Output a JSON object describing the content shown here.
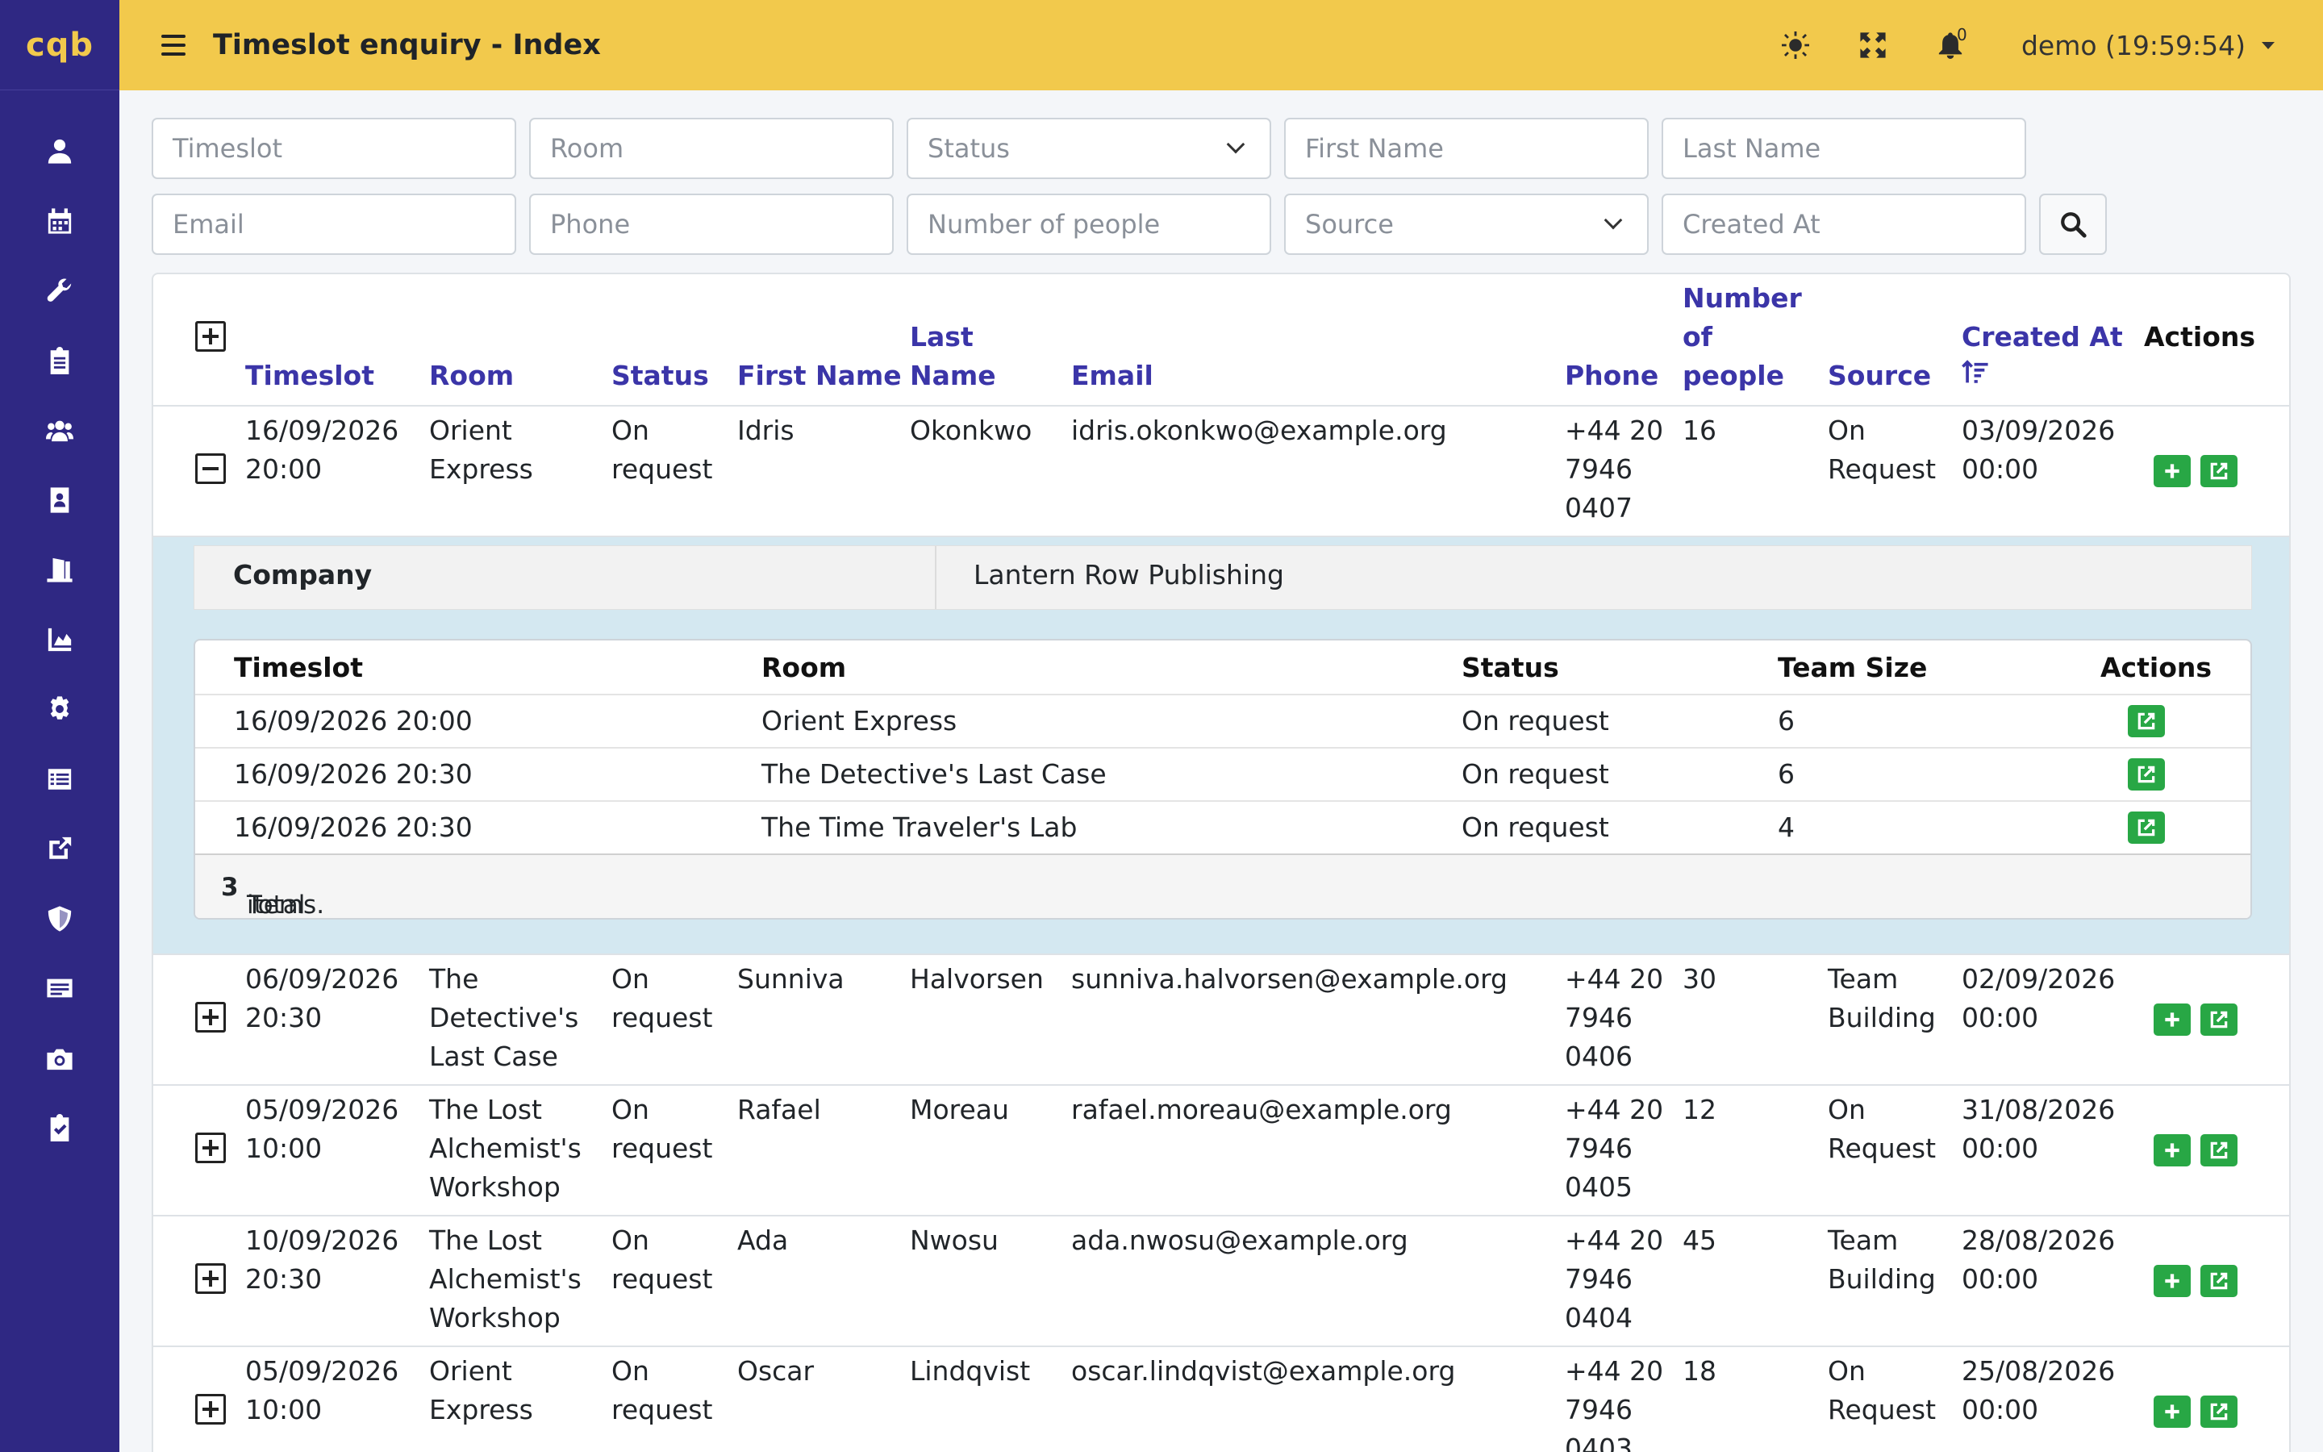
{
  "app": {
    "logo": "cqb"
  },
  "header": {
    "title": "Timeslot enquiry - Index",
    "notification_count": "0",
    "user": "demo (19:59:54)"
  },
  "sidebar": {
    "items": [
      {
        "icon": "user-icon"
      },
      {
        "icon": "calendar-icon"
      },
      {
        "icon": "wrench-icon"
      },
      {
        "icon": "clipboard-icon"
      },
      {
        "icon": "users-icon"
      },
      {
        "icon": "address-book-icon"
      },
      {
        "icon": "door-icon"
      },
      {
        "icon": "chart-area-icon"
      },
      {
        "icon": "cog-icon"
      },
      {
        "icon": "list-icon"
      },
      {
        "icon": "external-link-icon"
      },
      {
        "icon": "shield-icon"
      },
      {
        "icon": "ticket-icon"
      },
      {
        "icon": "camera-icon"
      },
      {
        "icon": "clipboard-check-icon"
      }
    ]
  },
  "filters": {
    "timeslot": "Timeslot",
    "room": "Room",
    "status": "Status",
    "first_name": "First Name",
    "last_name": "Last Name",
    "email": "Email",
    "phone": "Phone",
    "people": "Number of people",
    "source": "Source",
    "created_at": "Created At"
  },
  "table": {
    "headers": {
      "timeslot": "Timeslot",
      "room": "Room",
      "status": "Status",
      "first_name": "First Name",
      "last_name_1": "Last",
      "last_name_2": "Name",
      "email": "Email",
      "phone": "Phone",
      "people_1": "Number",
      "people_2": "of",
      "people_3": "people",
      "source": "Source",
      "created_at": "Created At",
      "actions": "Actions"
    },
    "rows": [
      {
        "ts1": "16/09/2026",
        "ts2": "20:00",
        "room1": "Orient",
        "room2": "Express",
        "room3": "",
        "st1": "On",
        "st2": "request",
        "first": "Idris",
        "last": "Okonkwo",
        "email": "idris.okonkwo@example.org",
        "ph1": "+44 20",
        "ph2": "7946",
        "ph3": "0407",
        "people": "16",
        "src1": "On",
        "src2": "Request",
        "cr1": "03/09/2026",
        "cr2": "00:00"
      },
      {
        "ts1": "06/09/2026",
        "ts2": "20:30",
        "room1": "The",
        "room2": "Detective's",
        "room3": "Last Case",
        "st1": "On",
        "st2": "request",
        "first": "Sunniva",
        "last": "Halvorsen",
        "email": "sunniva.halvorsen@example.org",
        "ph1": "+44 20",
        "ph2": "7946",
        "ph3": "0406",
        "people": "30",
        "src1": "Team",
        "src2": "Building",
        "cr1": "02/09/2026",
        "cr2": "00:00"
      },
      {
        "ts1": "05/09/2026",
        "ts2": "10:00",
        "room1": "The Lost",
        "room2": "Alchemist's",
        "room3": "Workshop",
        "st1": "On",
        "st2": "request",
        "first": "Rafael",
        "last": "Moreau",
        "email": "rafael.moreau@example.org",
        "ph1": "+44 20",
        "ph2": "7946",
        "ph3": "0405",
        "people": "12",
        "src1": "On",
        "src2": "Request",
        "cr1": "31/08/2026",
        "cr2": "00:00"
      },
      {
        "ts1": "10/09/2026",
        "ts2": "20:30",
        "room1": "The Lost",
        "room2": "Alchemist's",
        "room3": "Workshop",
        "st1": "On",
        "st2": "request",
        "first": "Ada",
        "last": "Nwosu",
        "email": "ada.nwosu@example.org",
        "ph1": "+44 20",
        "ph2": "7946",
        "ph3": "0404",
        "people": "45",
        "src1": "Team",
        "src2": "Building",
        "cr1": "28/08/2026",
        "cr2": "00:00"
      },
      {
        "ts1": "05/09/2026",
        "ts2": "10:00",
        "room1": "Orient",
        "room2": "Express",
        "room3": "",
        "st1": "On",
        "st2": "request",
        "first": "Oscar",
        "last": "Lindqvist",
        "email": "oscar.lindqvist@example.org",
        "ph1": "+44 20",
        "ph2": "7946",
        "ph3": "0403",
        "people": "18",
        "src1": "On",
        "src2": "Request",
        "cr1": "25/08/2026",
        "cr2": "00:00"
      }
    ]
  },
  "detail": {
    "company_label": "Company",
    "company_value": "Lantern Row Publishing",
    "sub_headers": {
      "timeslot": "Timeslot",
      "room": "Room",
      "status": "Status",
      "team_size": "Team Size",
      "actions": "Actions"
    },
    "sub_rows": [
      {
        "timeslot": "16/09/2026 20:00",
        "room": "Orient Express",
        "status": "On request",
        "team_size": "6"
      },
      {
        "timeslot": "16/09/2026 20:30",
        "room": "The Detective's Last Case",
        "status": "On request",
        "team_size": "6"
      },
      {
        "timeslot": "16/09/2026 20:30",
        "room": "The Time Traveler's Lab",
        "status": "On request",
        "team_size": "4"
      }
    ],
    "footer_pre": "Total ",
    "footer_count": "3",
    "footer_post": " items."
  }
}
